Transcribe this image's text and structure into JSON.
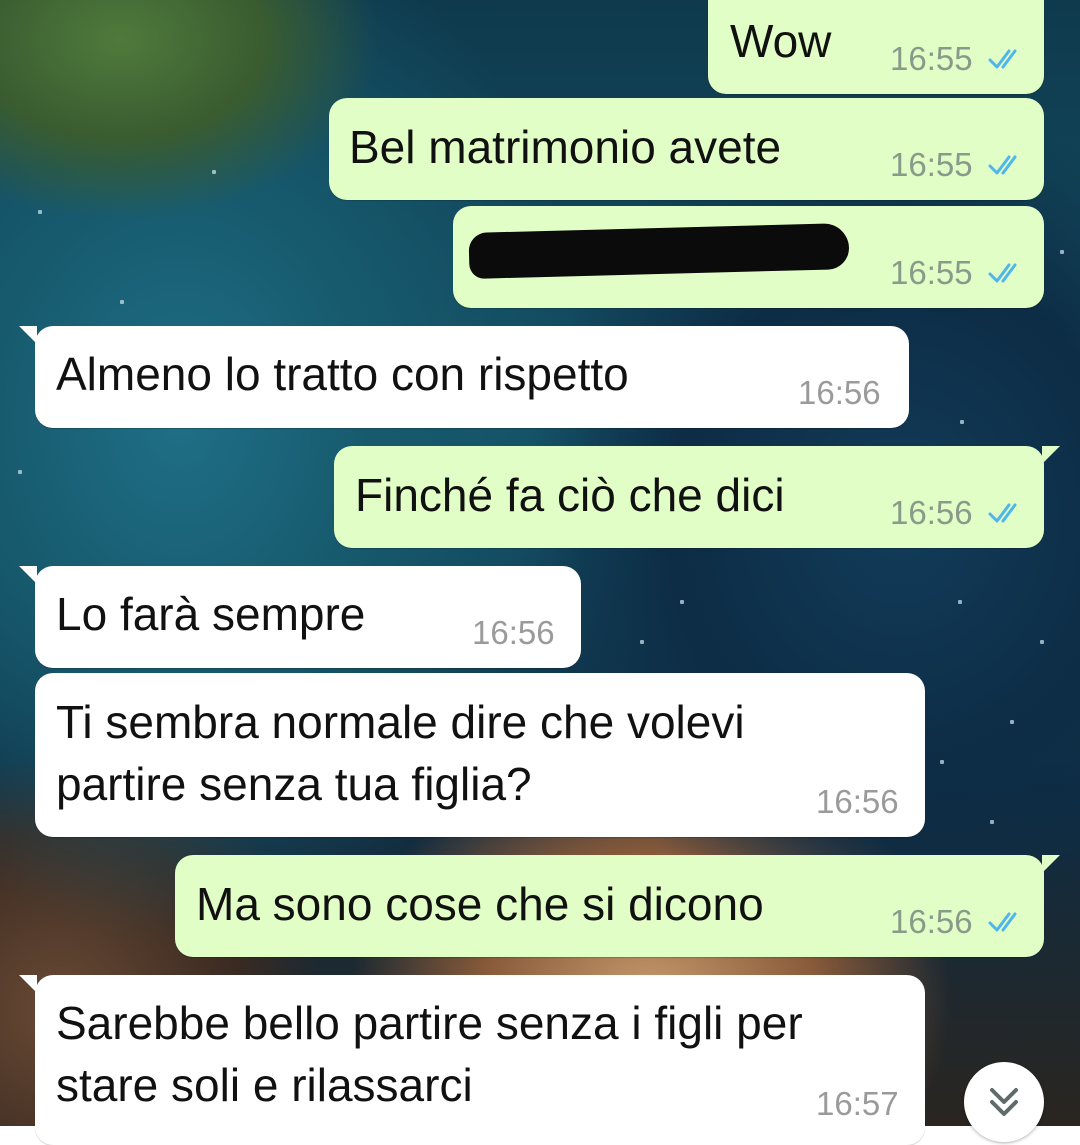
{
  "chat": {
    "messages": [
      {
        "direction": "outgoing",
        "text": "Wow",
        "time": "16:55",
        "status": "read"
      },
      {
        "direction": "outgoing",
        "text": "Bel matrimonio avete",
        "time": "16:55",
        "status": "read"
      },
      {
        "direction": "outgoing",
        "text": "",
        "redacted": true,
        "time": "16:55",
        "status": "read"
      },
      {
        "direction": "incoming",
        "text": "Almeno lo tratto con rispetto",
        "time": "16:56"
      },
      {
        "direction": "outgoing",
        "text": "Finché fa ciò che dici",
        "time": "16:56",
        "status": "read"
      },
      {
        "direction": "incoming",
        "text": "Lo farà sempre",
        "time": "16:56"
      },
      {
        "direction": "incoming",
        "lines": [
          "Ti sembra normale dire che volevi",
          "partire senza tua figlia?"
        ],
        "time": "16:56"
      },
      {
        "direction": "outgoing",
        "text": "Ma sono cose che si dicono",
        "time": "16:56",
        "status": "read"
      },
      {
        "direction": "incoming",
        "lines": [
          "Sarebbe bello partire senza i figli per",
          "stare soli e rilassarci"
        ],
        "time": "16:57"
      }
    ]
  },
  "icons": {
    "read_receipt": "double-check-icon",
    "scroll_down": "chevron-double-down-icon"
  },
  "colors": {
    "outgoing_bubble": "#e1fec6",
    "incoming_bubble": "#ffffff",
    "read_ticks": "#4fb6ec"
  }
}
